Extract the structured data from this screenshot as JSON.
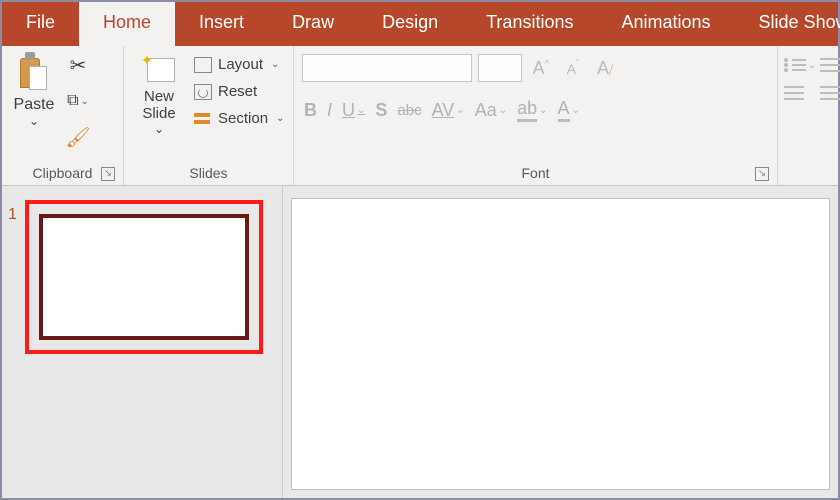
{
  "tabs": {
    "file": "File",
    "home": "Home",
    "insert": "Insert",
    "draw": "Draw",
    "design": "Design",
    "transitions": "Transitions",
    "animations": "Animations",
    "slideshow": "Slide Show"
  },
  "clipboard": {
    "paste": "Paste",
    "group_label": "Clipboard"
  },
  "slides": {
    "new_slide": "New\nSlide",
    "layout": "Layout",
    "reset": "Reset",
    "section": "Section",
    "group_label": "Slides"
  },
  "font": {
    "bold": "B",
    "italic": "I",
    "underline": "U",
    "shadow": "S",
    "strike": "abc",
    "spacing": "AV",
    "case": "Aa",
    "highlight": "ab",
    "color": "A",
    "grow": "A",
    "shrink": "A",
    "clear": "A",
    "group_label": "Font"
  },
  "thumb": {
    "number": "1"
  }
}
